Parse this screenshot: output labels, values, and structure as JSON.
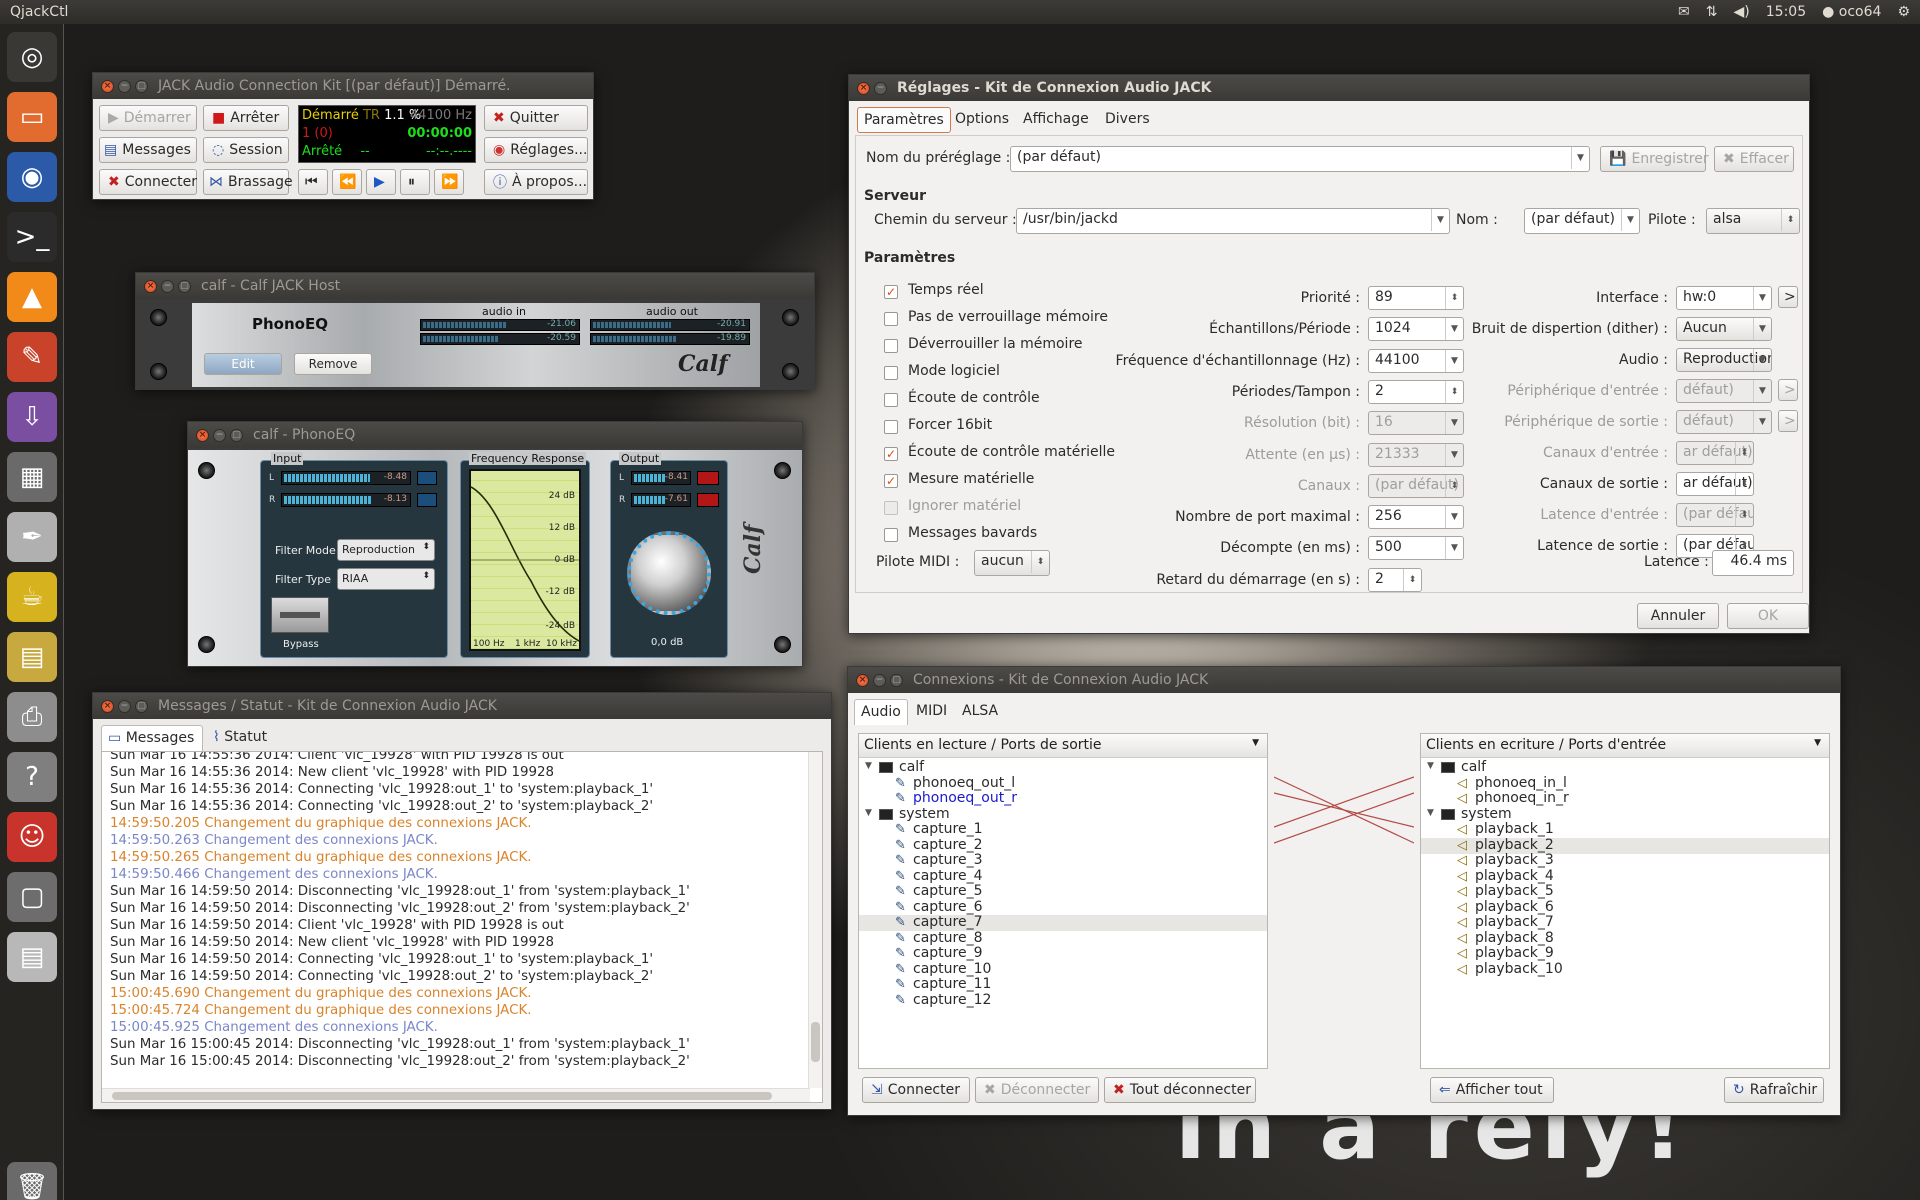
{
  "top_panel": {
    "app_name": "QjackCtl",
    "time": "15:05",
    "user": "oco64"
  },
  "wallpaper": {
    "text": "in a rely!"
  },
  "launcher": {
    "icons": [
      "ubuntu-icon",
      "files-icon",
      "firefox-icon",
      "terminal-icon",
      "vlc-icon",
      "settings-icon",
      "installer-icon",
      "calculator-icon",
      "pen-icon",
      "teapot-icon",
      "archive-icon",
      "scanner-icon",
      "help-icon",
      "mascot-icon",
      "window-icon",
      "floppy-icon",
      "trash-icon"
    ]
  },
  "jack_main": {
    "title": "JACK Audio Connection Kit [(par défaut)] Démarré.",
    "buttons": {
      "start": "Démarrer",
      "stop": "Arrêter",
      "quit": "Quitter",
      "messages": "Messages",
      "session": "Session",
      "settings": "Réglages...",
      "connect": "Connecter",
      "patchbay": "Brassage",
      "about": "À propos..."
    },
    "display": {
      "status": "Démarré",
      "rt": "TR",
      "dsp": "1.1 %",
      "rate": "44100 Hz",
      "xruns": "1 (0)",
      "time": "00:00:00",
      "transport": "Arrêté",
      "dash": "--",
      "bbt": "--:--.----"
    }
  },
  "calf_host": {
    "title": "calf - Calf JACK Host",
    "plugin": "PhonoEQ",
    "audio_in": "audio in",
    "audio_out": "audio out",
    "in_l": "-21.06",
    "in_r": "-20.59",
    "out_l": "-20.91",
    "out_r": "-19.89",
    "edit": "Edit",
    "remove": "Remove",
    "in_levels": [
      0.55,
      0.5
    ],
    "out_levels": [
      0.52,
      0.55
    ]
  },
  "phonoeq": {
    "title": "calf - PhonoEQ",
    "input_label": "Input",
    "freq_label": "Frequency Response",
    "output_label": "Output",
    "in_l": "-8.48",
    "in_r": "-8.13",
    "out_l": "-8.41",
    "out_r": "-7.61",
    "filter_mode_label": "Filter Mode",
    "filter_mode": "Reproduction",
    "filter_type_label": "Filter Type",
    "filter_type": "RIAA",
    "bypass": "Bypass",
    "gain": "0,0 dB",
    "db_ticks": [
      "24 dB",
      "12 dB",
      "0 dB",
      "-12 dB",
      "-24 dB"
    ],
    "freq_ticks": [
      "100 Hz",
      "1 kHz",
      "10 kHz"
    ],
    "in_levels": [
      0.7,
      0.72
    ],
    "out_levels": [
      0.6,
      0.62
    ]
  },
  "messages": {
    "title": "Messages / Statut - Kit de Connexion Audio JACK",
    "tab_messages": "Messages",
    "tab_status": "Statut",
    "lines": [
      {
        "t": "Sun Mar 16 14:55:36 2014: Client 'vlc_19928' with PID 19928 is out",
        "c": "k"
      },
      {
        "t": "Sun Mar 16 14:55:36 2014: New client 'vlc_19928' with PID 19928",
        "c": "k"
      },
      {
        "t": "Sun Mar 16 14:55:36 2014: Connecting 'vlc_19928:out_1' to 'system:playback_1'",
        "c": "k"
      },
      {
        "t": "Sun Mar 16 14:55:36 2014: Connecting 'vlc_19928:out_2' to 'system:playback_2'",
        "c": "k"
      },
      {
        "t": "14:59:50.205 Changement du graphique des connexions JACK.",
        "c": "o"
      },
      {
        "t": "14:59:50.263 Changement des connexions JACK.",
        "c": "b"
      },
      {
        "t": "14:59:50.265 Changement du graphique des connexions JACK.",
        "c": "o"
      },
      {
        "t": "14:59:50.466 Changement des connexions JACK.",
        "c": "b"
      },
      {
        "t": "Sun Mar 16 14:59:50 2014: Disconnecting 'vlc_19928:out_1' from 'system:playback_1'",
        "c": "k"
      },
      {
        "t": "Sun Mar 16 14:59:50 2014: Disconnecting 'vlc_19928:out_2' from 'system:playback_2'",
        "c": "k"
      },
      {
        "t": "Sun Mar 16 14:59:50 2014: Client 'vlc_19928' with PID 19928 is out",
        "c": "k"
      },
      {
        "t": "Sun Mar 16 14:59:50 2014: New client 'vlc_19928' with PID 19928",
        "c": "k"
      },
      {
        "t": "Sun Mar 16 14:59:50 2014: Connecting 'vlc_19928:out_1' to 'system:playback_1'",
        "c": "k"
      },
      {
        "t": "Sun Mar 16 14:59:50 2014: Connecting 'vlc_19928:out_2' to 'system:playback_2'",
        "c": "k"
      },
      {
        "t": "15:00:45.690 Changement du graphique des connexions JACK.",
        "c": "o"
      },
      {
        "t": "15:00:45.724 Changement du graphique des connexions JACK.",
        "c": "o"
      },
      {
        "t": "15:00:45.925 Changement des connexions JACK.",
        "c": "b"
      },
      {
        "t": "Sun Mar 16 15:00:45 2014: Disconnecting 'vlc_19928:out_1' from 'system:playback_1'",
        "c": "k"
      },
      {
        "t": "Sun Mar 16 15:00:45 2014: Disconnecting 'vlc_19928:out_2' from 'system:playback_2'",
        "c": "k"
      }
    ]
  },
  "settings": {
    "title": "Réglages - Kit de Connexion Audio JACK",
    "tabs": [
      "Paramètres",
      "Options",
      "Affichage",
      "Divers"
    ],
    "preset_label": "Nom du préréglage :",
    "preset": "(par défaut)",
    "save": "Enregistrer",
    "delete": "Effacer",
    "server_heading": "Serveur",
    "server_path_label": "Chemin du serveur :",
    "server_path": "/usr/bin/jackd",
    "name_label": "Nom :",
    "name": "(par défaut)",
    "driver_label": "Pilote :",
    "driver": "alsa",
    "params_heading": "Paramètres",
    "checks": [
      {
        "label": "Temps réel",
        "on": true,
        "dis": false
      },
      {
        "label": "Pas de verrouillage mémoire",
        "on": false,
        "dis": false
      },
      {
        "label": "Déverrouiller la mémoire",
        "on": false,
        "dis": false
      },
      {
        "label": "Mode logiciel",
        "on": false,
        "dis": false
      },
      {
        "label": "Écoute de contrôle",
        "on": false,
        "dis": false
      },
      {
        "label": "Forcer 16bit",
        "on": false,
        "dis": false
      },
      {
        "label": "Écoute de contrôle matérielle",
        "on": true,
        "dis": false
      },
      {
        "label": "Mesure matérielle",
        "on": true,
        "dis": false
      },
      {
        "label": "Ignorer matériel",
        "on": false,
        "dis": true
      },
      {
        "label": "Messages bavards",
        "on": false,
        "dis": false
      }
    ],
    "midi_label": "Pilote MIDI :",
    "midi": "aucun",
    "mid": [
      {
        "label": "Priorité :",
        "value": "89",
        "dis": false,
        "spin": true
      },
      {
        "label": "Échantillons/Période :",
        "value": "1024",
        "dis": false
      },
      {
        "label": "Fréquence d'échantillonnage (Hz) :",
        "value": "44100",
        "dis": false
      },
      {
        "label": "Périodes/Tampon :",
        "value": "2",
        "dis": false,
        "spin": true
      },
      {
        "label": "Résolution (bit) :",
        "value": "16",
        "dis": true
      },
      {
        "label": "Attente (en µs) :",
        "value": "21333",
        "dis": true
      },
      {
        "label": "Canaux :",
        "value": "(par défaut)",
        "dis": true,
        "spin": true
      },
      {
        "label": "Nombre de port maximal :",
        "value": "256",
        "dis": false
      },
      {
        "label": "Décompte (en ms) :",
        "value": "500",
        "dis": false
      },
      {
        "label": "Retard du démarrage (en s) :",
        "value": "2",
        "dis": false,
        "spin": true
      }
    ],
    "right": [
      {
        "label": "Interface :",
        "value": "hw:0",
        "dis": false
      },
      {
        "label": "Bruit de dispertion (dither) :",
        "value": "Aucun",
        "dis": false
      },
      {
        "label": "Audio :",
        "value": "Reproduction",
        "dis": false
      },
      {
        "label": "Périphérique d'entrée :",
        "value": "défaut)",
        "dis": true
      },
      {
        "label": "Périphérique de sortie :",
        "value": "défaut)",
        "dis": true
      },
      {
        "label": "Canaux d'entrée :",
        "value": "ar défaut)",
        "dis": true
      },
      {
        "label": "Canaux de sortie :",
        "value": "ar défaut)",
        "dis": false
      },
      {
        "label": "Latence d'entrée :",
        "value": "(par défaut)",
        "dis": true
      },
      {
        "label": "Latence de sortie :",
        "value": "(par défaut)",
        "dis": false
      }
    ],
    "latency_label": "Latence :",
    "latency": "46.4 ms",
    "cancel": "Annuler",
    "ok": "OK",
    "arrow": ">"
  },
  "connections": {
    "title": "Connexions - Kit de Connexion Audio JACK",
    "tabs": [
      "Audio",
      "MIDI",
      "ALSA"
    ],
    "left_header": "Clients en lecture / Ports de sortie",
    "right_header": "Clients en ecriture / Ports d'entrée",
    "left_tree": [
      {
        "text": "calf",
        "lvl": 0
      },
      {
        "text": "phonoeq_out_l",
        "lvl": 1
      },
      {
        "text": "phonoeq_out_r",
        "lvl": 1,
        "link": true
      },
      {
        "text": "system",
        "lvl": 0
      },
      {
        "text": "capture_1",
        "lvl": 1
      },
      {
        "text": "capture_2",
        "lvl": 1
      },
      {
        "text": "capture_3",
        "lvl": 1
      },
      {
        "text": "capture_4",
        "lvl": 1
      },
      {
        "text": "capture_5",
        "lvl": 1
      },
      {
        "text": "capture_6",
        "lvl": 1
      },
      {
        "text": "capture_7",
        "lvl": 1,
        "sel": true
      },
      {
        "text": "capture_8",
        "lvl": 1
      },
      {
        "text": "capture_9",
        "lvl": 1
      },
      {
        "text": "capture_10",
        "lvl": 1
      },
      {
        "text": "capture_11",
        "lvl": 1
      },
      {
        "text": "capture_12",
        "lvl": 1
      }
    ],
    "right_tree": [
      {
        "text": "calf",
        "lvl": 0
      },
      {
        "text": "phonoeq_in_l",
        "lvl": 1
      },
      {
        "text": "phonoeq_in_r",
        "lvl": 1
      },
      {
        "text": "system",
        "lvl": 0
      },
      {
        "text": "playback_1",
        "lvl": 1
      },
      {
        "text": "playback_2",
        "lvl": 1,
        "sel": true
      },
      {
        "text": "playback_3",
        "lvl": 1
      },
      {
        "text": "playback_4",
        "lvl": 1
      },
      {
        "text": "playback_5",
        "lvl": 1
      },
      {
        "text": "playback_6",
        "lvl": 1
      },
      {
        "text": "playback_7",
        "lvl": 1
      },
      {
        "text": "playback_8",
        "lvl": 1
      },
      {
        "text": "playback_9",
        "lvl": 1
      },
      {
        "text": "playback_10",
        "lvl": 1
      }
    ],
    "connect": "Connecter",
    "disconnect": "Déconnecter",
    "disconnect_all": "Tout déconnecter",
    "expand_all": "Afficher tout",
    "refresh": "Rafraîchir"
  },
  "colors": {
    "accent": "#df4a19",
    "link": "#1a1acc",
    "log_orange": "#d9832b",
    "log_blue": "#7b86c8"
  }
}
